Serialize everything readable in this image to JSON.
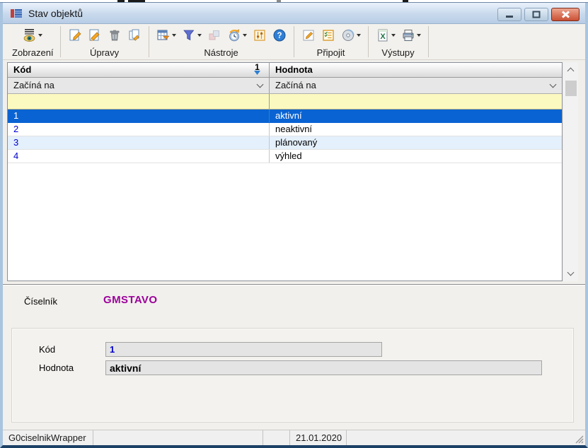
{
  "window": {
    "title": "Stav objektů",
    "controls": [
      "minimize",
      "maximize",
      "close"
    ]
  },
  "toolbar": {
    "groups": [
      {
        "label": "Zobrazení",
        "icons": [
          "view-eye-icon"
        ]
      },
      {
        "label": "Úpravy",
        "icons": [
          "new-record-icon",
          "edit-record-icon",
          "delete-record-icon",
          "copy-record-icon"
        ]
      },
      {
        "label": "Nástroje",
        "icons": [
          "table-settings-icon",
          "filter-icon",
          "link-icon",
          "refresh-icon",
          "parameters-icon",
          "help-icon"
        ]
      },
      {
        "label": "Připojit",
        "icons": [
          "note-edit-icon",
          "checklist-icon",
          "media-icon"
        ]
      },
      {
        "label": "Výstupy",
        "icons": [
          "excel-export-icon",
          "print-icon"
        ]
      }
    ]
  },
  "table": {
    "columns": [
      {
        "header": "Kód",
        "sort_order": "1"
      },
      {
        "header": "Hodnota"
      }
    ],
    "filter": {
      "kod": "Začíná na",
      "hodnota": "Začíná na"
    },
    "search": {
      "kod": "",
      "hodnota": ""
    },
    "rows": [
      {
        "kod": "1",
        "hodnota": "aktivní",
        "selected": true
      },
      {
        "kod": "2",
        "hodnota": "neaktivní",
        "selected": false
      },
      {
        "kod": "3",
        "hodnota": "plánovaný",
        "selected": false
      },
      {
        "kod": "4",
        "hodnota": "výhled",
        "selected": false
      }
    ]
  },
  "detail": {
    "ciselnik_label": "Číselník",
    "ciselnik_value": "GMSTAVO",
    "fields": [
      {
        "label": "Kód",
        "value": "1"
      },
      {
        "label": "Hodnota",
        "value": "aktivní"
      }
    ]
  },
  "statusbar": {
    "cells": [
      "G0ciselnikWrapper",
      "",
      "",
      "21.01.2020",
      ""
    ]
  },
  "colors": {
    "selection": "#0a63d2",
    "code_text": "#0000cd",
    "ciselnik_value": "#9b009b",
    "search_row": "#fbf9c0",
    "window_border": "#a9c4df"
  }
}
